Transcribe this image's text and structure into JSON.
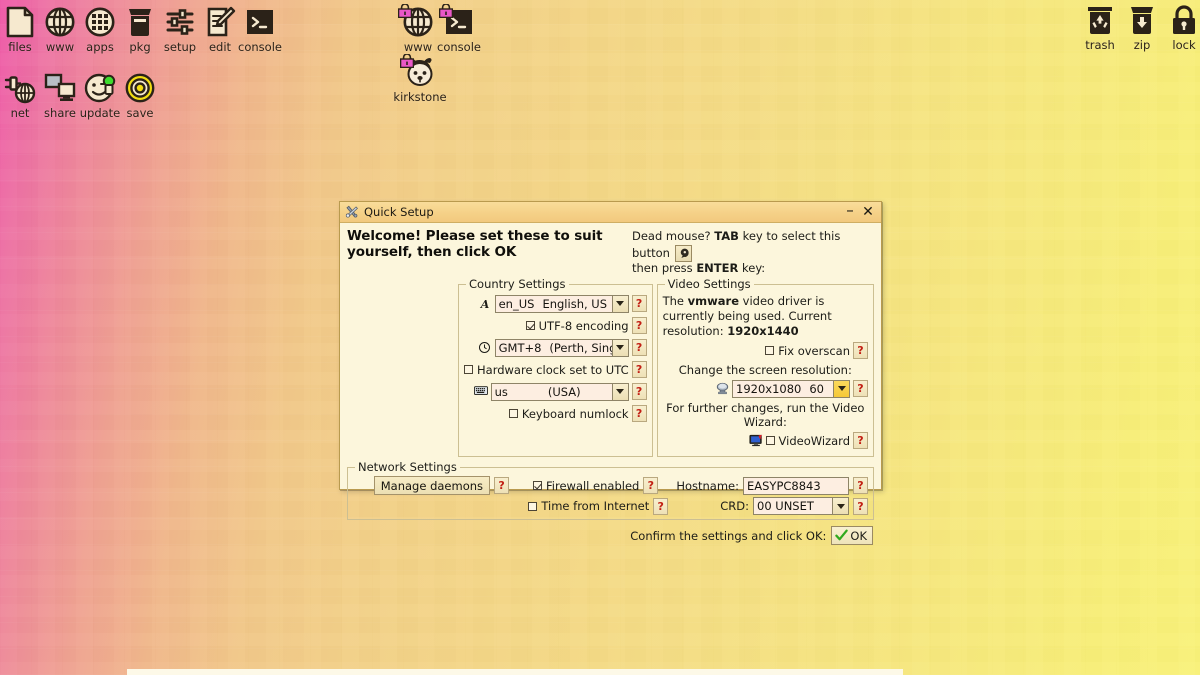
{
  "desktop": {
    "icons_left": [
      {
        "name": "files",
        "label": "files",
        "icon": "file-icon",
        "locked": false
      },
      {
        "name": "www",
        "label": "www",
        "icon": "globe-icon",
        "locked": false
      },
      {
        "name": "apps",
        "label": "apps",
        "icon": "grid-icon",
        "locked": false
      },
      {
        "name": "pkg",
        "label": "pkg",
        "icon": "box-icon",
        "locked": false
      },
      {
        "name": "setup",
        "label": "setup",
        "icon": "sliders-icon",
        "locked": false
      },
      {
        "name": "edit",
        "label": "edit",
        "icon": "pencil-icon",
        "locked": false
      },
      {
        "name": "console",
        "label": "console",
        "icon": "terminal-icon",
        "locked": false
      },
      {
        "name": "net",
        "label": "net",
        "icon": "plug-icon",
        "locked": false
      },
      {
        "name": "share",
        "label": "share",
        "icon": "screens-icon",
        "locked": false
      },
      {
        "name": "update",
        "label": "update",
        "icon": "face-icon",
        "locked": false
      },
      {
        "name": "save",
        "label": "save",
        "icon": "target-icon",
        "locked": false
      }
    ],
    "icons_center": [
      {
        "name": "www-locked",
        "label": "www",
        "icon": "globe-icon",
        "locked": true
      },
      {
        "name": "console-locked",
        "label": "console",
        "icon": "terminal-icon",
        "locked": true
      },
      {
        "name": "kirkstone-locked",
        "label": "kirkstone",
        "icon": "puppy-icon",
        "locked": true
      }
    ],
    "icons_right": [
      {
        "name": "trash",
        "label": "trash",
        "icon": "trash-icon",
        "locked": false
      },
      {
        "name": "zip",
        "label": "zip",
        "icon": "download-icon",
        "locked": false
      },
      {
        "name": "lock",
        "label": "lock",
        "icon": "padlock-icon",
        "locked": false
      }
    ]
  },
  "dialog": {
    "title": "Quick Setup",
    "title_icon": "tools-icon",
    "minimize_label": "–",
    "close_label": "✕",
    "welcome": "Welcome! Please set these to suit yourself, then click OK",
    "deadmouse": {
      "part1": "Dead mouse? ",
      "key1": "TAB",
      "part2": " key to select this button ",
      "part3": "then press ",
      "key2": "ENTER",
      "part4": " key:",
      "button_icon": "mouse-icon"
    },
    "country": {
      "legend": "Country Settings",
      "locale": {
        "icon": "font-a-icon",
        "code": "en_US",
        "desc": "English, US",
        "help": "?"
      },
      "utf8": {
        "label": "UTF-8 encoding",
        "checked": true,
        "help": "?"
      },
      "timezone": {
        "icon": "clock-icon",
        "code": "GMT+8",
        "desc": "(Perth, Sing",
        "help": "?"
      },
      "hwclock": {
        "label": "Hardware clock set to UTC",
        "checked": false,
        "help": "?"
      },
      "keyboard": {
        "icon": "keyboard-icon",
        "code": "us",
        "desc": "(USA)",
        "help": "?"
      },
      "numlock": {
        "label": "Keyboard numlock",
        "checked": false,
        "help": "?"
      }
    },
    "video": {
      "legend": "Video Settings",
      "driver_text_1": "The ",
      "driver_name": "vmware",
      "driver_text_2": " video driver is currently being used. Current resolution: ",
      "current_resolution": "1920x1440",
      "overscan": {
        "label": "Fix overscan",
        "checked": false,
        "help": "?"
      },
      "change_caption": "Change the screen resolution:",
      "resolution": {
        "icon": "monitor-small-icon",
        "value": "1920x1080",
        "refresh": "60",
        "help": "?"
      },
      "wizard_caption": "For further changes, run the Video Wizard:",
      "wizard": {
        "icon": "monitor-icon",
        "label": "VideoWizard",
        "checked": false,
        "help": "?"
      }
    },
    "network": {
      "legend": "Network Settings",
      "manage_daemons": {
        "label": "Manage daemons",
        "help": "?"
      },
      "firewall": {
        "label": "Firewall enabled",
        "checked": true,
        "help": "?"
      },
      "time_internet": {
        "label": "Time from Internet",
        "checked": false,
        "help": "?"
      },
      "hostname": {
        "label": "Hostname:",
        "value": "EASYPC8843",
        "help": "?"
      },
      "crd": {
        "label": "CRD:",
        "value": "00 UNSET",
        "help": "?"
      }
    },
    "footer": {
      "confirm_text": "Confirm the settings and click OK:",
      "ok_label": "OK",
      "ok_icon": "check-icon"
    }
  },
  "colors": {
    "dialog_bg": "#fcf6dc",
    "titlebar": "#f5d188",
    "field_bg": "#fdeee1",
    "help_red": "#c21f14",
    "ok_green": "#2faa1e",
    "focus_yellow": "#f5c937",
    "lock_pink": "#e957c8"
  }
}
